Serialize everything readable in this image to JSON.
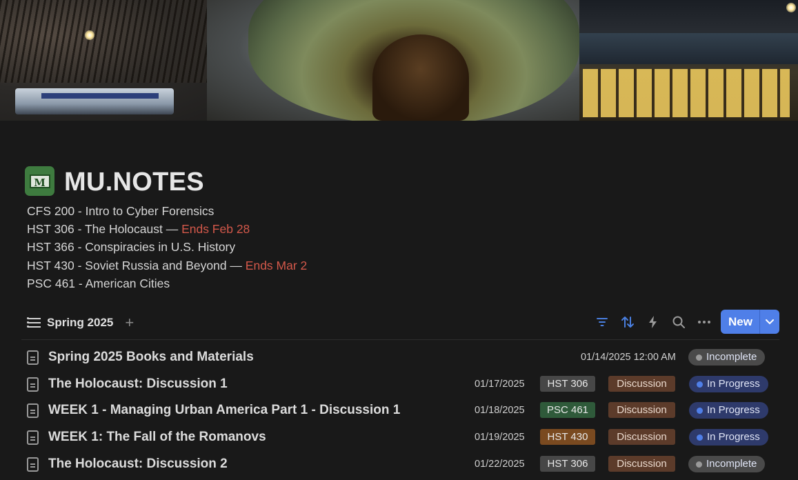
{
  "page": {
    "title": "MU.NOTES",
    "icon": "marshall-m-logo-icon"
  },
  "courses": [
    {
      "text": "CFS 200 - Intro to Cyber Forensics",
      "suffix": "",
      "ends": ""
    },
    {
      "text": "HST 306 - The Holocaust",
      "suffix": " — ",
      "ends": "Ends Feb 28"
    },
    {
      "text": "HST 366 - Conspiracies in U.S. History",
      "suffix": "",
      "ends": ""
    },
    {
      "text": "HST 430 - Soviet Russia and Beyond",
      "suffix": " — ",
      "ends": "Ends Mar 2"
    },
    {
      "text": "PSC 461 - American Cities",
      "suffix": "",
      "ends": ""
    }
  ],
  "view": {
    "name": "Spring 2025",
    "add_icon": "plus-icon",
    "new_label": "New"
  },
  "toolbar_icons": [
    "filter-icon",
    "sort-icon",
    "lightning-icon",
    "search-icon",
    "more-icon"
  ],
  "colors": {
    "accent": "#4f7fe8",
    "ends_red": "#d3584a",
    "status_in_progress": "#2e3a6b",
    "status_incomplete": "#4a4a4a"
  },
  "rows": [
    {
      "title": "Spring 2025 Books and Materials",
      "date": "01/14/2025 12:00 AM",
      "course": "",
      "course_color": "",
      "type": "",
      "status": "Incomplete",
      "status_kind": "incomplete"
    },
    {
      "title": "The Holocaust: Discussion 1",
      "date": "01/17/2025",
      "course": "HST 306",
      "course_color": "#474747",
      "type": "Discussion",
      "status": "In Progress",
      "status_kind": "progress"
    },
    {
      "title": "WEEK 1 - Managing Urban America Part 1 - Discussion 1",
      "date": "01/18/2025",
      "course": "PSC 461",
      "course_color": "#2f5a3a",
      "type": "Discussion",
      "status": "In Progress",
      "status_kind": "progress"
    },
    {
      "title": "WEEK 1: The Fall of the Romanovs",
      "date": "01/19/2025",
      "course": "HST 430",
      "course_color": "#7a4a20",
      "type": "Discussion",
      "status": "In Progress",
      "status_kind": "progress"
    },
    {
      "title": "The Holocaust: Discussion 2",
      "date": "01/22/2025",
      "course": "HST 306",
      "course_color": "#474747",
      "type": "Discussion",
      "status": "Incomplete",
      "status_kind": "incomplete"
    }
  ]
}
